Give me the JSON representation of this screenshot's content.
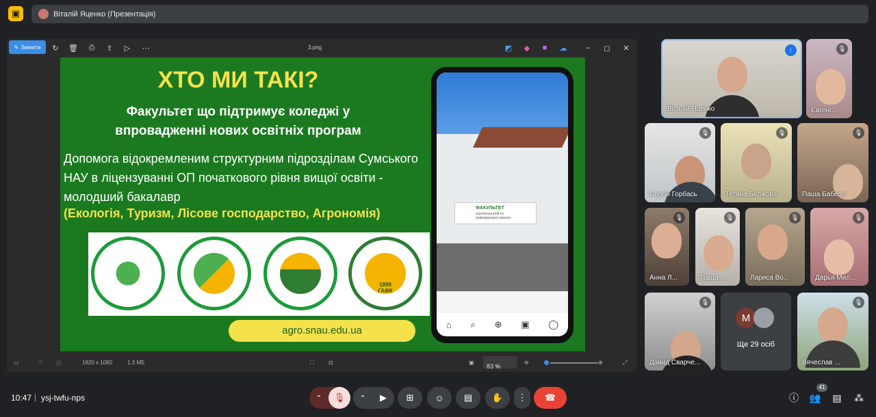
{
  "header": {
    "presenter_label": "Віталій Яценко (Презентація)"
  },
  "viewer": {
    "edit_label": "Змінити",
    "filename": "3.png",
    "dimensions": "1920 x 1080",
    "filesize": "1.3 МБ",
    "zoom": "83 %"
  },
  "slide": {
    "title": "ХТО МИ ТАКІ?",
    "subtitle": "Факультет що підтримує коледжі у впровадженні нових освітніх програм",
    "body": " Допомога відокремленим структурним підрозділам Сумського НАУ в ліцензуванні ОП початкового рівня вищої освіти - молодший бакалавр",
    "highlight": "(Екологія, Туризм, Лісове господарство, Агрономія)",
    "url": "agro.snau.edu.ua",
    "logo_year": "1899",
    "logo_abbr": "ГАФК"
  },
  "phone": {
    "sign_title": "ФАКУЛЬТЕТ",
    "sign_sub": "агротехнологій та природокористування"
  },
  "participants": [
    {
      "name": "Віталій Яценко"
    },
    {
      "name": "Євгені..."
    },
    {
      "name": "Сергій Горбась"
    },
    {
      "name": "Тетяна Бєлікова"
    },
    {
      "name": "Паша Бабело"
    },
    {
      "name": "Анна Л..."
    },
    {
      "name": "Паша ..."
    },
    {
      "name": "Лариса Во..."
    },
    {
      "name": "Дарья Мил..."
    },
    {
      "name": "Давид Сварче..."
    },
    {
      "name": "Вячеслав ..."
    }
  ],
  "more": {
    "initial": "М",
    "label": "Ще 29 осіб"
  },
  "bottom": {
    "time": "10:47",
    "separator": "|",
    "meeting_code": "ysj-twfu-nps",
    "people_count": "41"
  }
}
